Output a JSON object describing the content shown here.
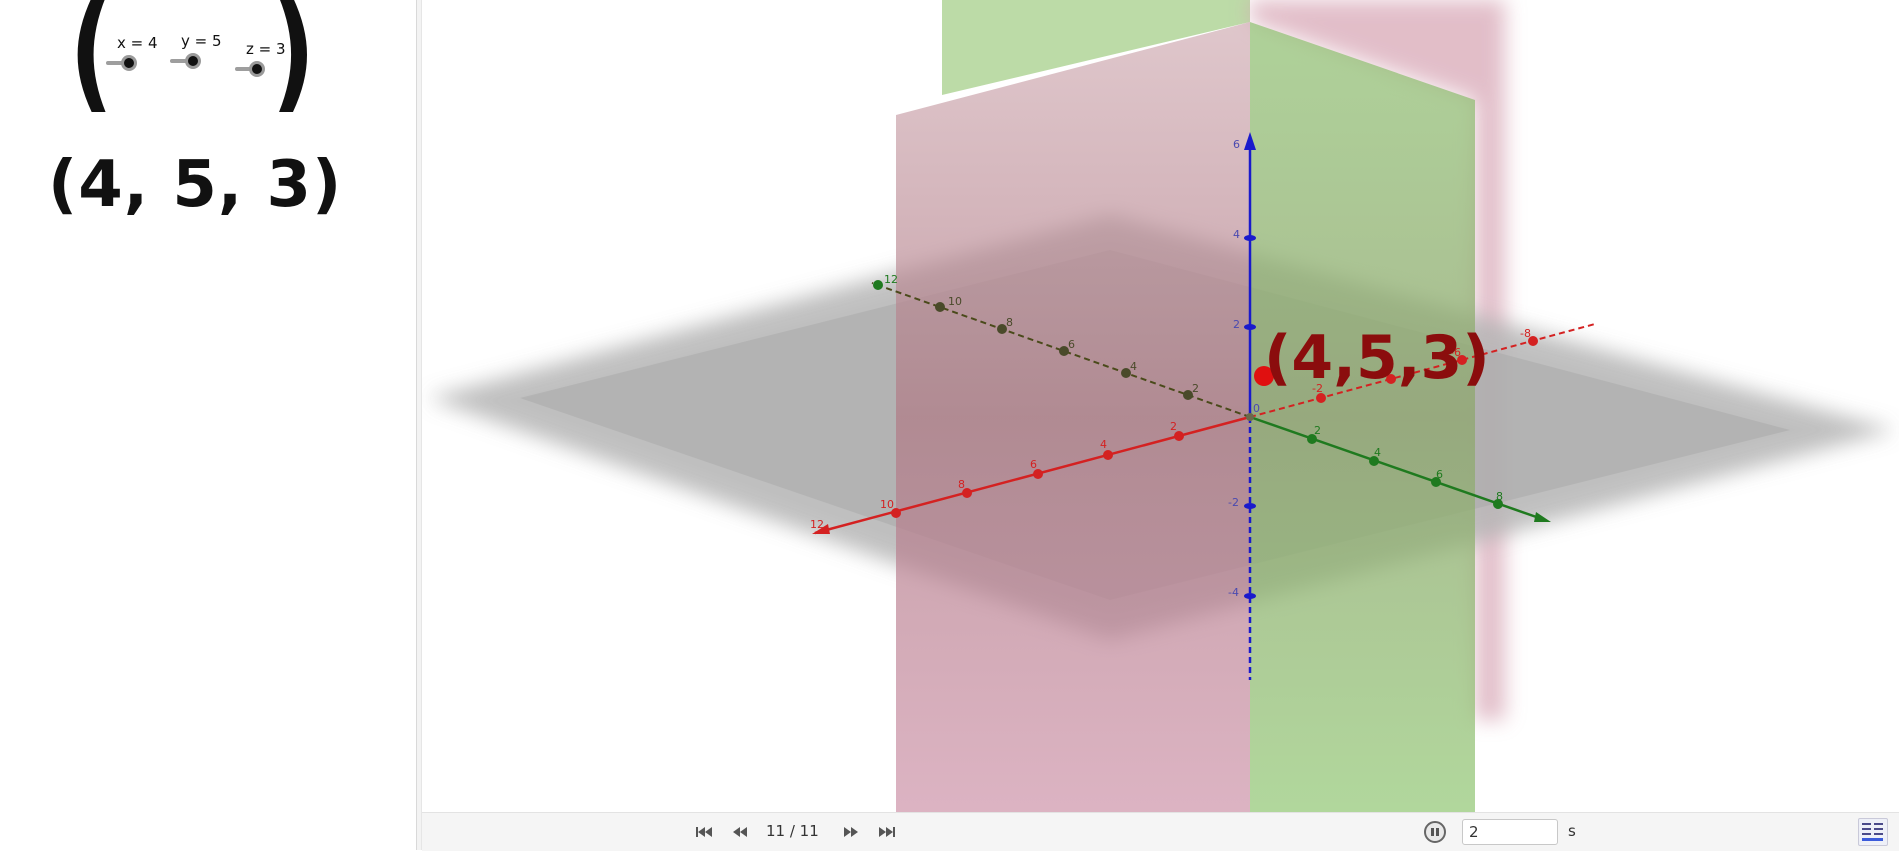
{
  "sliders": [
    {
      "name": "x",
      "label": "x = 4",
      "value": 4
    },
    {
      "name": "y",
      "label": "y = 5",
      "value": 5
    },
    {
      "name": "z",
      "label": "z = 3",
      "value": 3
    }
  ],
  "open_paren": "(",
  "close_paren": ")",
  "point_text": "(4, 5, 3)",
  "view3d": {
    "point_label": "(4,5,3)",
    "x_axis_ticks": [
      "12",
      "10",
      "8",
      "6",
      "4",
      "2",
      "-2",
      "-6",
      "-8"
    ],
    "y_axis_ticks": [
      "12",
      "10",
      "8",
      "6",
      "4",
      "2",
      "2",
      "4",
      "6",
      "8"
    ],
    "z_axis_ticks": [
      "6",
      "4",
      "2",
      "0",
      "-2",
      "-4"
    ],
    "colors": {
      "x_axis": "#d42121",
      "y_axis": "#1f7a1f",
      "z_axis": "#1a1acc",
      "point": "#e01010",
      "point_label": "#8b0d0d",
      "plane_xy": "#b3b3b3",
      "plane_red": "#c7889a",
      "plane_green": "#8ebf6a"
    }
  },
  "toolbar": {
    "step": "11 / 11",
    "speed_value": "2",
    "speed_unit": "s",
    "icons": [
      "skip-first-icon",
      "step-back-icon",
      "step-forward-icon",
      "skip-last-icon",
      "pause-icon",
      "algebra-view-icon"
    ]
  }
}
